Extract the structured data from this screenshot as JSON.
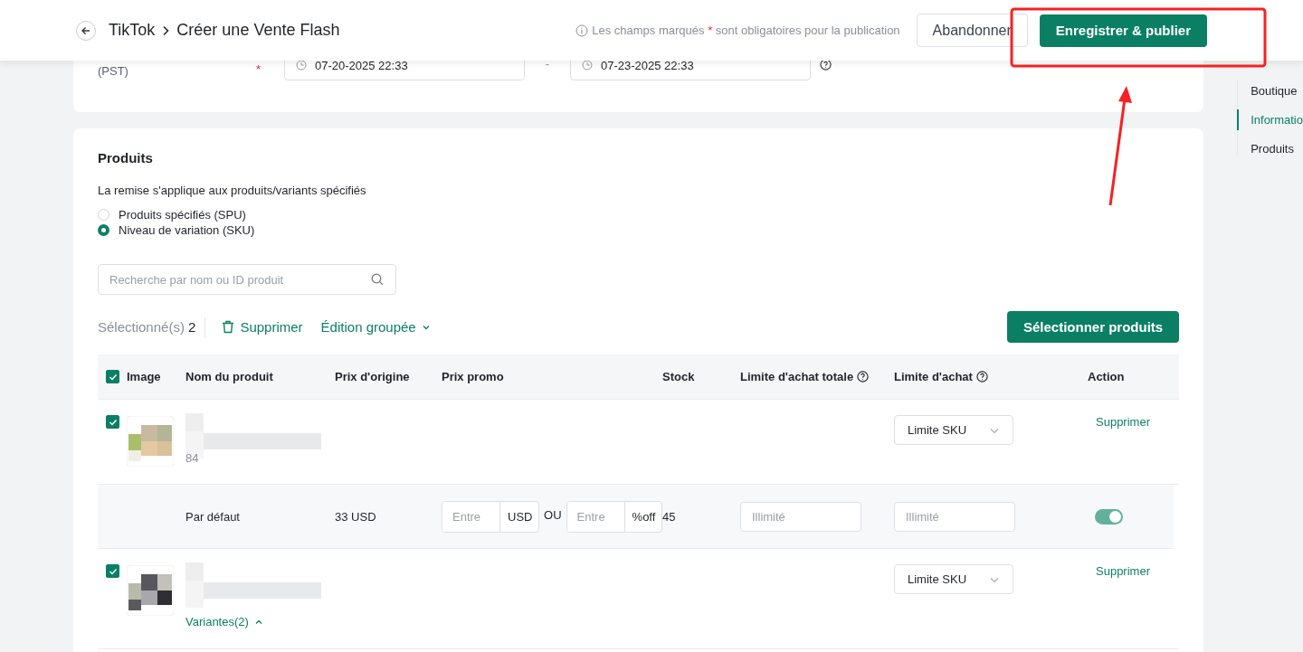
{
  "header": {
    "breadcrumb": [
      "TikTok",
      "Créer une Vente Flash"
    ],
    "notice_before": "Les champs marqués",
    "required_mark": "*",
    "notice_after": "sont obligatoires pour la publication",
    "cancel_button": "Abandonner",
    "publish_button": "Enregistrer & publier"
  },
  "period": {
    "label": "(PST)",
    "required_mark": "*",
    "start": "07-20-2025 22:33",
    "separator": "-",
    "end": "07-23-2025 22:33"
  },
  "side_nav": [
    {
      "label": "Boutique",
      "selected": false
    },
    {
      "label": "Informatio",
      "selected": true
    },
    {
      "label": "Produits",
      "selected": false
    }
  ],
  "products": {
    "title": "Produits",
    "description": "La remise s'applique aux produits/variants spécifiés",
    "scope_options": [
      {
        "label": "Produits spécifiés (SPU)",
        "selected": false
      },
      {
        "label": "Niveau de variation (SKU)",
        "selected": true
      }
    ],
    "search": {
      "placeholder": "Recherche par nom ou ID produit"
    },
    "toolbar": {
      "selected_label": "Sélectionné(s)",
      "selected_count": "2",
      "delete": "Supprimer",
      "bulk_edit": "Édition groupée",
      "select_button": "Sélectionner produits"
    },
    "table": {
      "all_checked": true,
      "columns": [
        {
          "label": "Image",
          "help": false
        },
        {
          "label": "Nom du produit",
          "help": false
        },
        {
          "label": "Prix d'origine",
          "help": false
        },
        {
          "label": "Prix promo",
          "help": false
        },
        {
          "label": "Stock",
          "help": false
        },
        {
          "label": "Limite d'achat totale",
          "help": true
        },
        {
          "label": "Limite d'achat",
          "help": true
        },
        {
          "label": "Action",
          "help": false
        }
      ],
      "rows": [
        {
          "kind": "product",
          "checked": true,
          "subtitle": "84",
          "limit_select": "Limite SKU",
          "action": "Supprimer"
        },
        {
          "kind": "variant",
          "name": "Par défaut",
          "price": "33 USD",
          "promo_placeholder": "Entre",
          "currency": "USD",
          "or": "OU",
          "percent_placeholder": "Entre",
          "percent_unit": "%off",
          "stock": "45",
          "total_limit_placeholder": "Illimité",
          "limit_placeholder": "Illimité",
          "on": true
        },
        {
          "kind": "product",
          "checked": true,
          "limit_select": "Limite SKU",
          "action": "Supprimer",
          "variants_link": "Variantes(2)",
          "expanded": true
        }
      ]
    }
  }
}
